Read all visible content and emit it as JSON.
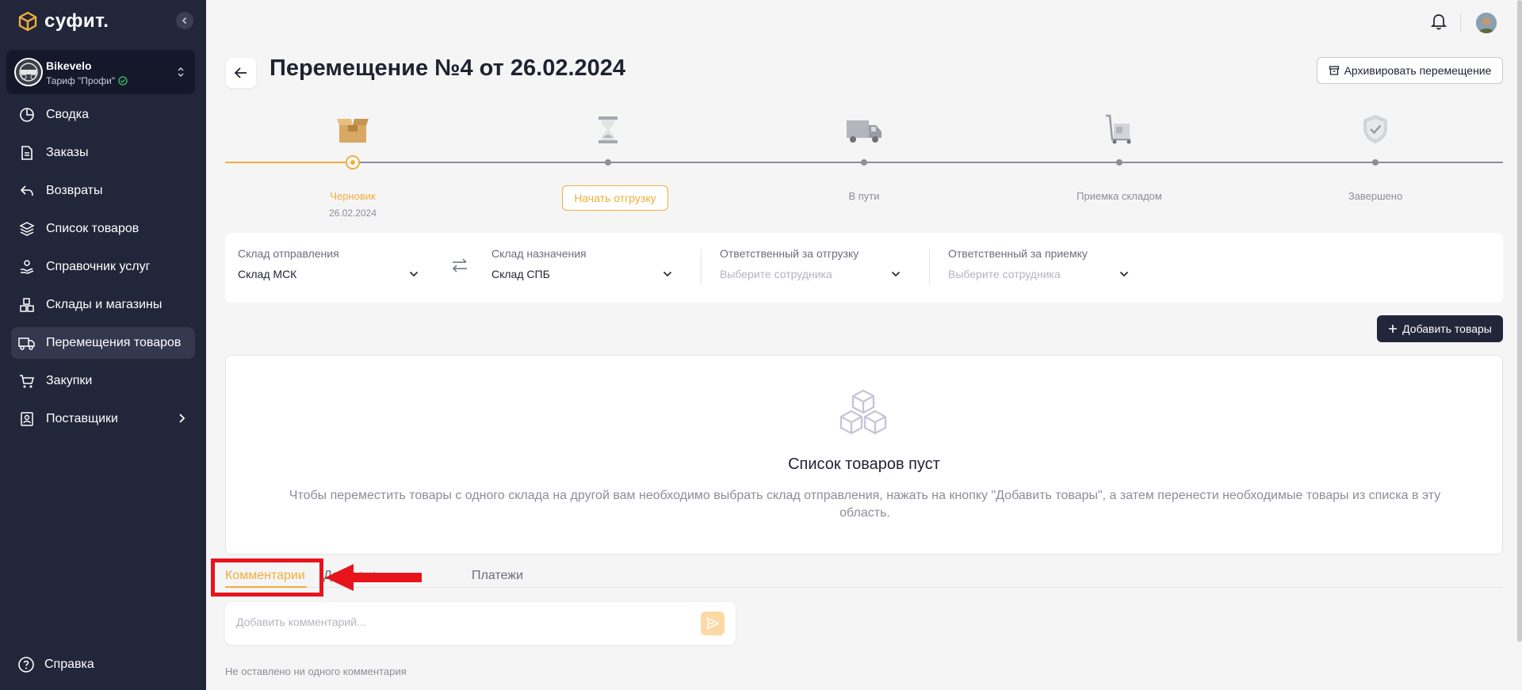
{
  "app": {
    "logo_text": "суфит."
  },
  "account": {
    "name": "Bikevelo",
    "plan": "Тариф \"Профи\""
  },
  "sidebar": {
    "items": [
      {
        "label": "Сводка",
        "icon": "chart-pie-icon",
        "active": false
      },
      {
        "label": "Заказы",
        "icon": "document-icon",
        "active": false
      },
      {
        "label": "Возвраты",
        "icon": "return-arrow-icon",
        "active": false
      },
      {
        "label": "Список товаров",
        "icon": "layers-icon",
        "active": false
      },
      {
        "label": "Справочник услуг",
        "icon": "hand-service-icon",
        "active": false
      },
      {
        "label": "Склады и магазины",
        "icon": "boxes-icon",
        "active": false
      },
      {
        "label": "Перемещения товаров",
        "icon": "truck-icon",
        "active": true
      },
      {
        "label": "Закупки",
        "icon": "cart-icon",
        "active": false
      },
      {
        "label": "Поставщики",
        "icon": "contacts-icon",
        "active": false
      }
    ],
    "help_label": "Справка"
  },
  "header": {
    "title": "Перемещение №4 от 26.02.2024",
    "archive_label": "Архивировать перемещение"
  },
  "stepper": {
    "steps": [
      {
        "label": "Черновик",
        "date": "26.02.2024",
        "icon": "open-box-icon",
        "state": "current"
      },
      {
        "label": "Начать отгрузку",
        "icon": "hourglass-icon",
        "state": "action"
      },
      {
        "label": "В пути",
        "icon": "delivery-truck-icon",
        "state": "pending"
      },
      {
        "label": "Приемка складом",
        "icon": "hand-cart-icon",
        "state": "pending"
      },
      {
        "label": "Завершено",
        "icon": "shield-check-icon",
        "state": "pending"
      }
    ]
  },
  "warehouse": {
    "from": {
      "label": "Склад отправления",
      "value": "Склад МСК"
    },
    "to": {
      "label": "Склад назначения",
      "value": "Склад СПБ"
    },
    "shipper": {
      "label": "Ответственный за отгрузку",
      "placeholder": "Выберите сотрудника"
    },
    "receiver": {
      "label": "Ответственный за приемку",
      "placeholder": "Выберите сотрудника"
    }
  },
  "add_products_label": "Добавить товары",
  "empty_state": {
    "title": "Список товаров пуст",
    "description": "Чтобы переместить товары с одного склада на другой вам необходимо выбрать склад отправления, нажать на кнопку \"Добавить товары\", а затем перенести необходимые товары из списка в эту область."
  },
  "tabs": [
    {
      "label": "Комментарии",
      "active": true
    },
    {
      "label": "Доставка",
      "active": false
    },
    {
      "label": "Платежи",
      "active": false
    }
  ],
  "comments": {
    "placeholder": "Добавить комментарий...",
    "empty_text": "Не оставлено ни одного комментария"
  },
  "colors": {
    "sidebar_bg": "#22263a",
    "accent": "#f2ad3b",
    "annotation_red": "#e8141c"
  }
}
